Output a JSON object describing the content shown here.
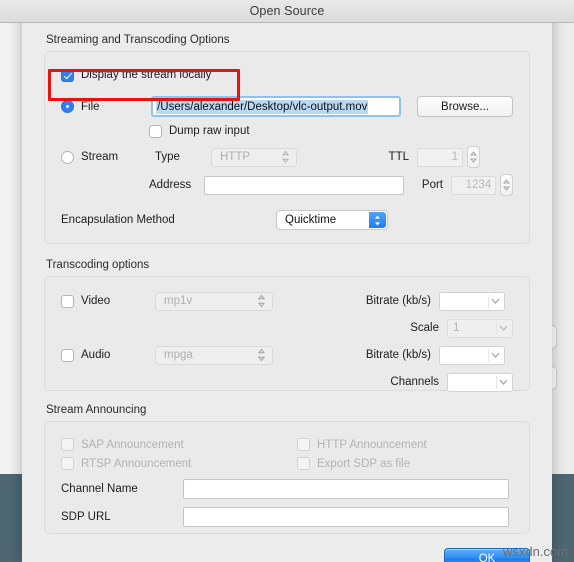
{
  "window": {
    "title": "Open Source"
  },
  "sections": {
    "streaming": {
      "label": "Streaming and Transcoding Options",
      "display_locally": {
        "label": "Display the stream locally",
        "checked": true,
        "highlight_color": "#e8130e"
      },
      "file": {
        "radio_label": "File",
        "selected": true,
        "path_value": "/Users/alexander/Desktop/vlc-output.mov",
        "browse_label": "Browse..."
      },
      "dump_raw_input": {
        "label": "Dump raw input",
        "checked": false
      },
      "stream": {
        "radio_label": "Stream",
        "selected": false,
        "type_label": "Type",
        "type_value": "HTTP",
        "address_label": "Address",
        "address_value": "",
        "ttl_label": "TTL",
        "ttl_value": "1",
        "port_label": "Port",
        "port_value": "1234"
      },
      "encapsulation": {
        "label": "Encapsulation Method",
        "value": "Quicktime"
      }
    },
    "transcoding": {
      "label": "Transcoding options",
      "video": {
        "label": "Video",
        "checked": false,
        "codec_value": "mp1v",
        "bitrate_label": "Bitrate (kb/s)",
        "bitrate_value": "",
        "scale_label": "Scale",
        "scale_value": "1"
      },
      "audio": {
        "label": "Audio",
        "checked": false,
        "codec_value": "mpga",
        "bitrate_label": "Bitrate (kb/s)",
        "bitrate_value": "",
        "channels_label": "Channels",
        "channels_value": ""
      }
    },
    "announcing": {
      "label": "Stream Announcing",
      "sap": {
        "label": "SAP Announcement",
        "checked": false
      },
      "rtsp": {
        "label": "RTSP Announcement",
        "checked": false
      },
      "http": {
        "label": "HTTP Announcement",
        "checked": false
      },
      "export_sdp": {
        "label": "Export SDP as file",
        "checked": false
      },
      "channel_name": {
        "label": "Channel Name",
        "value": ""
      },
      "sdp_url": {
        "label": "SDP URL",
        "value": ""
      }
    }
  },
  "footer": {
    "ok_label": "OK",
    "watermark": "wsxdn.com"
  }
}
